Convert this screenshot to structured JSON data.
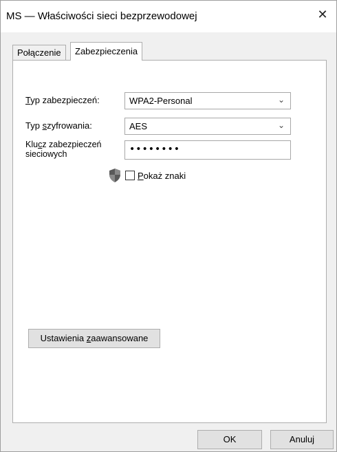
{
  "window": {
    "title": "MS — Właściwości sieci bezprzewodowej",
    "close_symbol": "✕"
  },
  "tabs": [
    {
      "label": "Połączenie",
      "active": false
    },
    {
      "label": "Zabezpieczenia",
      "active": true
    }
  ],
  "security": {
    "type_label_u": "T",
    "type_label_rest": "yp zabezpieczeń:",
    "type_value": "WPA2-Personal",
    "encryption_label_pre": "Typ ",
    "encryption_label_u": "s",
    "encryption_label_rest": "zyfrowania:",
    "encryption_value": "AES",
    "key_label_pre": "Klu",
    "key_label_u": "c",
    "key_label_rest": "z zabezpieczeń",
    "key_label_line2": "sieciowych",
    "key_value": "••••••••",
    "show_chars_u": "P",
    "show_chars_rest": "okaż znaki",
    "show_chars_checked": false
  },
  "advanced_button": {
    "pre": "Ustawienia ",
    "u": "z",
    "rest": "aawansowane"
  },
  "footer": {
    "ok": "OK",
    "cancel": "Anuluj"
  },
  "icons": {
    "shield": "shield-icon",
    "chevron": "chevron-down-icon"
  }
}
